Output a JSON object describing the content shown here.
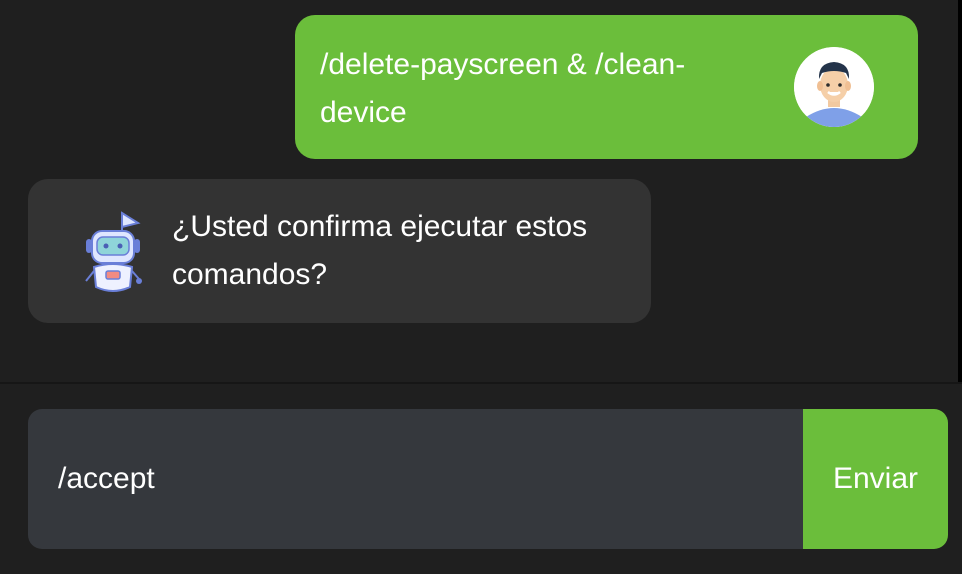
{
  "messages": {
    "user": {
      "text": "/delete-payscreen & /clean-device",
      "avatar_icon": "user-avatar-icon"
    },
    "bot": {
      "text": "¿Usted confirma ejecutar estos comandos?",
      "avatar_icon": "robot-icon"
    }
  },
  "composer": {
    "input_value": "/accept",
    "send_label": "Enviar"
  },
  "colors": {
    "background": "#1f1f1f",
    "user_bubble": "#6bbe3b",
    "bot_bubble": "#333333",
    "input_bg": "#35383d",
    "accent": "#6bbe3b"
  }
}
